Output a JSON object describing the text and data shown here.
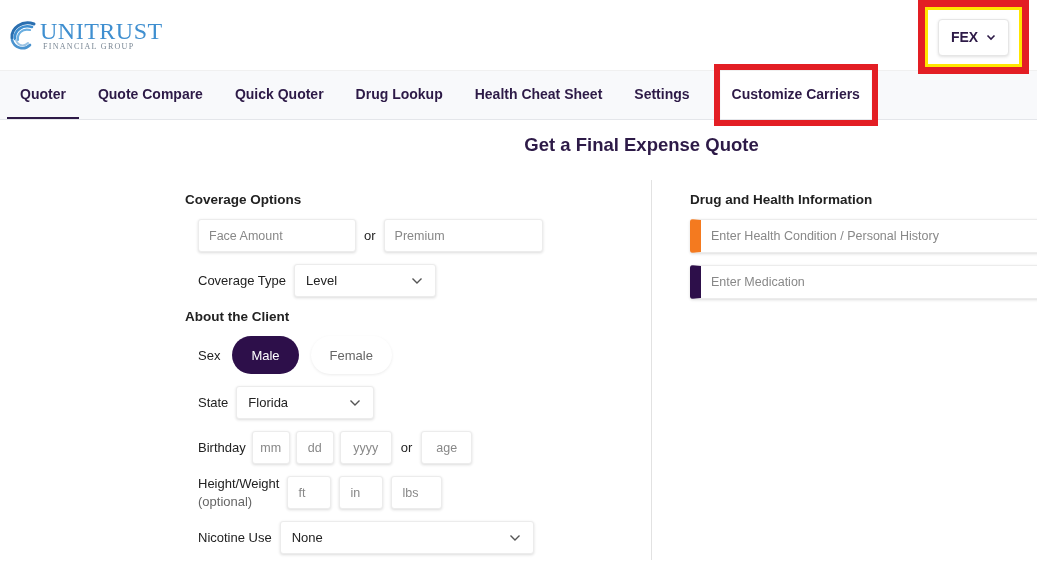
{
  "logo": {
    "name": "UNITRUST",
    "tagline": "FINANCIAL GROUP"
  },
  "product_selector": {
    "value": "FEX",
    "highlighted": true
  },
  "tabs": [
    {
      "label": "Quoter",
      "selected": true,
      "highlighted": false
    },
    {
      "label": "Quote Compare",
      "selected": false,
      "highlighted": false
    },
    {
      "label": "Quick Quoter",
      "selected": false,
      "highlighted": false
    },
    {
      "label": "Drug Lookup",
      "selected": false,
      "highlighted": false
    },
    {
      "label": "Health Cheat Sheet",
      "selected": false,
      "highlighted": false
    },
    {
      "label": "Settings",
      "selected": false,
      "highlighted": false
    },
    {
      "label": "Customize Carriers",
      "selected": false,
      "highlighted": true
    }
  ],
  "title": "Get a Final Expense Quote",
  "coverage_options": {
    "heading": "Coverage Options",
    "face_amount": {
      "placeholder": "Face Amount"
    },
    "separator": "or",
    "premium": {
      "placeholder": "Premium"
    },
    "coverage_type": {
      "label": "Coverage Type",
      "value": "Level"
    }
  },
  "about_client": {
    "heading": "About the Client",
    "sex": {
      "label": "Sex",
      "options": [
        {
          "label": "Male",
          "selected": true
        },
        {
          "label": "Female",
          "selected": false
        }
      ]
    },
    "state": {
      "label": "State",
      "value": "Florida"
    },
    "birthday": {
      "label": "Birthday",
      "fields": [
        {
          "placeholder": "mm"
        },
        {
          "placeholder": "dd"
        },
        {
          "placeholder": "yyyy"
        }
      ],
      "separator": "or",
      "age": {
        "placeholder": "age"
      }
    },
    "height_weight": {
      "label": "Height/Weight",
      "note": "(optional)",
      "fields": [
        {
          "placeholder": "ft"
        },
        {
          "placeholder": "in"
        },
        {
          "placeholder": "lbs"
        }
      ]
    },
    "nicotine_use": {
      "label": "Nicotine Use",
      "value": "None"
    }
  },
  "drug_health": {
    "heading": "Drug and Health Information",
    "fields": [
      {
        "placeholder": "Enter Health Condition / Personal History",
        "color": "#f47a1f"
      },
      {
        "placeholder": "Enter Medication",
        "color": "#2d0f4a"
      }
    ]
  }
}
